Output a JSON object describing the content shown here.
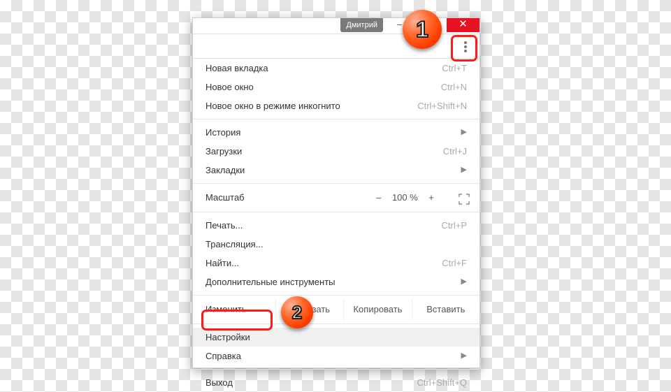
{
  "titlebar": {
    "user": "Дмитрий",
    "minimize": "–",
    "maximize": "❐",
    "close": "✕"
  },
  "callouts": {
    "one": "1",
    "two": "2"
  },
  "menu": {
    "new_tab": {
      "label": "Новая вкладка",
      "shortcut": "Ctrl+T"
    },
    "new_window": {
      "label": "Новое окно",
      "shortcut": "Ctrl+N"
    },
    "incognito": {
      "label": "Новое окно в режиме инкогнито",
      "shortcut": "Ctrl+Shift+N"
    },
    "history": {
      "label": "История"
    },
    "downloads": {
      "label": "Загрузки",
      "shortcut": "Ctrl+J"
    },
    "bookmarks": {
      "label": "Закладки"
    },
    "zoom": {
      "label": "Масштаб",
      "minus": "–",
      "value": "100 %",
      "plus": "+"
    },
    "print": {
      "label": "Печать...",
      "shortcut": "Ctrl+P"
    },
    "cast": {
      "label": "Трансляция..."
    },
    "find": {
      "label": "Найти...",
      "shortcut": "Ctrl+F"
    },
    "more_tools": {
      "label": "Дополнительные инструменты"
    },
    "edit": {
      "label": "Изменить",
      "cut": "Вырезать",
      "copy": "Копировать",
      "paste": "Вставить"
    },
    "settings": {
      "label": "Настройки"
    },
    "help": {
      "label": "Справка"
    },
    "exit": {
      "label": "Выход",
      "shortcut": "Ctrl+Shift+Q"
    }
  }
}
